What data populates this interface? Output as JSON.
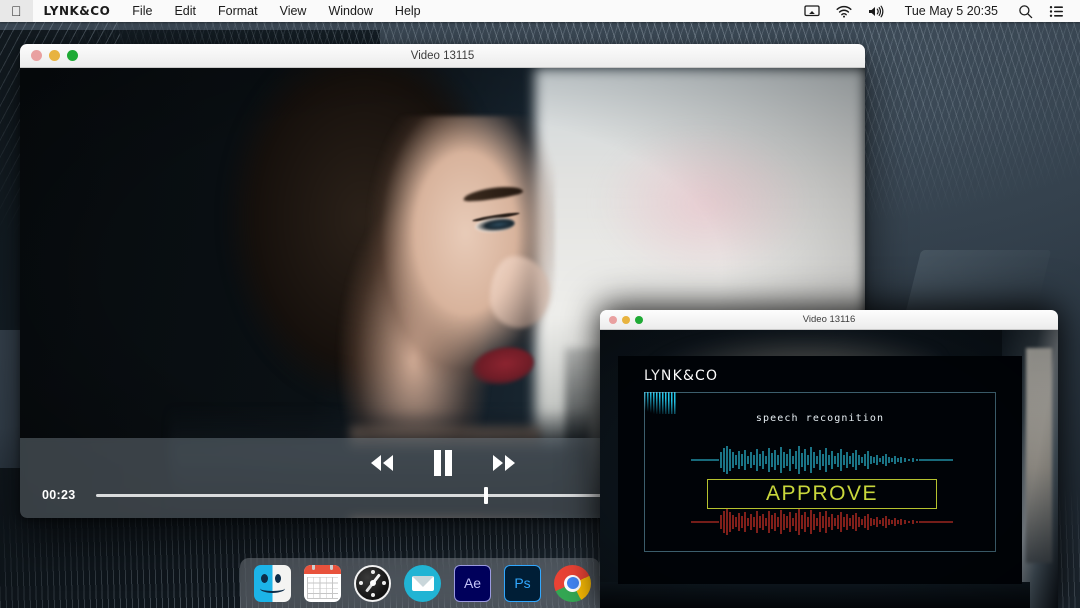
{
  "menubar": {
    "apple_icon": "apple-logo",
    "app_name": "LYNK&CO",
    "items": [
      "File",
      "Edit",
      "Format",
      "View",
      "Window",
      "Help"
    ],
    "status_icons": [
      "screen-mirroring-icon",
      "wifi-icon",
      "volume-icon"
    ],
    "clock": "Tue May 5 20:35",
    "search_icon": "search-icon",
    "control_center_icon": "control-center-icon"
  },
  "window1": {
    "title": "Video 13115",
    "traffic_lights": [
      "close",
      "minimize",
      "maximize"
    ],
    "player": {
      "rewind_label": "rewind",
      "pause_label": "pause",
      "forward_label": "fast-forward",
      "current_time": "00:23",
      "progress_percent": 52
    }
  },
  "window2": {
    "title": "Video 13116",
    "traffic_lights": [
      "close",
      "minimize",
      "maximize"
    ],
    "screen": {
      "brand": "LYNK&CO",
      "caption": "speech recognition",
      "command": "APPROVE",
      "waveform_top_color": "#2fd0ef",
      "waveform_bottom_color": "#e8372b",
      "command_color": "#c9d73c"
    }
  },
  "dock": {
    "items": [
      {
        "name": "Finder",
        "icon": "finder-icon"
      },
      {
        "name": "Calendar",
        "icon": "calendar-icon"
      },
      {
        "name": "Safari",
        "icon": "safari-icon"
      },
      {
        "name": "Mail",
        "icon": "mail-icon"
      },
      {
        "name": "After Effects",
        "icon": "after-effects-icon",
        "badge": "Ae"
      },
      {
        "name": "Photoshop",
        "icon": "photoshop-icon",
        "badge": "Ps"
      },
      {
        "name": "Chrome",
        "icon": "chrome-icon"
      }
    ]
  }
}
